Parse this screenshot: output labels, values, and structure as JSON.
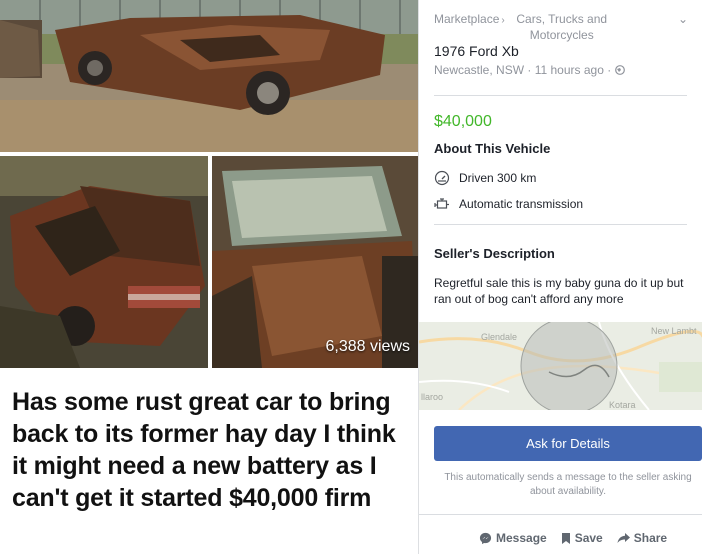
{
  "photos": {
    "views": "6,388 views",
    "caption": "Has some rust great car to bring back to its former hay day I think it might need a new battery as I can't get it started $40,000 firm"
  },
  "listing": {
    "breadcrumb_root": "Marketplace",
    "breadcrumb_category": "Cars, Trucks and Motorcycles",
    "title": "1976 Ford Xb",
    "location": "Newcastle, NSW",
    "posted": "11 hours ago",
    "price": "$40,000",
    "about_heading": "About This Vehicle",
    "features": [
      {
        "icon": "speedometer-icon",
        "label": "Driven 300 km"
      },
      {
        "icon": "engine-icon",
        "label": "Automatic transmission"
      }
    ],
    "seller_heading": "Seller's Description",
    "seller_description": "Regretful sale this is my baby guna do it up but ran out of bog can't afford any more"
  },
  "map": {
    "labels": [
      "Glendale",
      "New Lambt",
      "llaroo",
      "Kotara"
    ]
  },
  "contact": {
    "ask_label": "Ask for Details",
    "ask_note": "This automatically sends a message to the seller asking about availability."
  },
  "actions": {
    "message": "Message",
    "save": "Save",
    "share": "Share"
  },
  "colors": {
    "price": "#42b72a",
    "button": "#4267b2"
  }
}
